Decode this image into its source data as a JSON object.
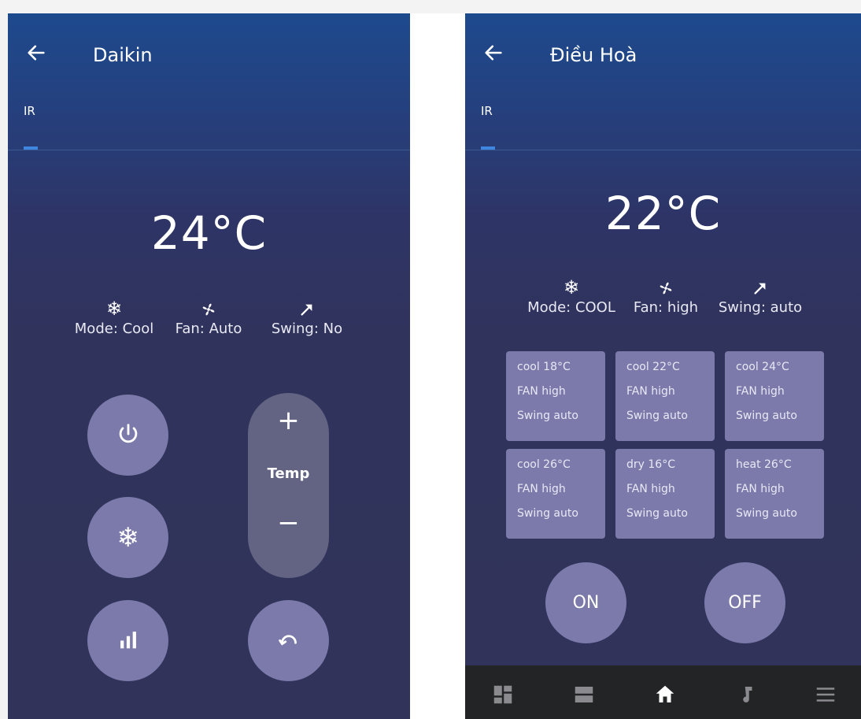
{
  "left": {
    "title": "Daikin",
    "tab": "IR",
    "temperature": "24°C",
    "stats": [
      {
        "icon": "snowflake-icon",
        "label": "Mode: Cool"
      },
      {
        "icon": "fan-icon",
        "label": "Fan: Auto"
      },
      {
        "icon": "swing-icon",
        "label": "Swing: No"
      }
    ],
    "buttons": {
      "power": "power-icon",
      "mode": "snowflake-icon",
      "fan": "signal-bars-icon",
      "swing": "swing-arc-icon"
    },
    "temp_control": {
      "plus": "+",
      "label": "Temp",
      "minus": "−"
    }
  },
  "right": {
    "title": "Điều Hoà",
    "tab": "IR",
    "temperature": "22°C",
    "stats": [
      {
        "icon": "snowflake-icon",
        "label": "Mode: COOL"
      },
      {
        "icon": "fan-icon",
        "label": "Fan: high"
      },
      {
        "icon": "swing-icon",
        "label": "Swing: auto"
      }
    ],
    "presets": [
      {
        "line1": "cool 18°C",
        "line2": "FAN high",
        "line3": "Swing auto"
      },
      {
        "line1": "cool 22°C",
        "line2": "FAN high",
        "line3": "Swing auto"
      },
      {
        "line1": "cool 24°C",
        "line2": "FAN high",
        "line3": "Swing auto"
      },
      {
        "line1": "cool 26°C",
        "line2": "FAN high",
        "line3": "Swing auto"
      },
      {
        "line1": "dry 16°C",
        "line2": "FAN high",
        "line3": "Swing auto"
      },
      {
        "line1": "heat 26°C",
        "line2": "FAN high",
        "line3": "Swing auto"
      }
    ],
    "on_label": "ON",
    "off_label": "OFF",
    "nav": [
      "dashboard-icon",
      "list-view-icon",
      "home-icon",
      "music-icon",
      "menu-icon"
    ]
  },
  "colors": {
    "header_blue": "#1d4a8d",
    "background_navy": "#31335a",
    "button_purple": "#7b7aaa",
    "pill_gray": "#636384",
    "tab_indicator": "#3f86e0",
    "nav_bar": "#232426"
  }
}
